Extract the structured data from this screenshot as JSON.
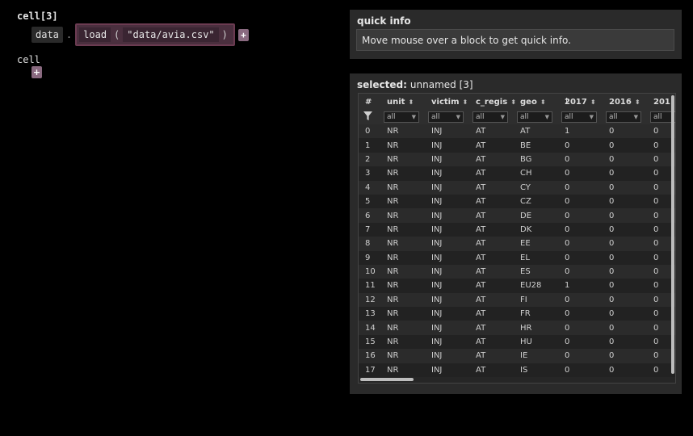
{
  "cells": {
    "cell1_title": "cell[3]",
    "obj_token": "data",
    "dot": ".",
    "fn_name": "load",
    "paren_open": "(",
    "arg": "\"data/avia.csv\"",
    "paren_close": ")",
    "plus": "+",
    "cell2_label": "cell"
  },
  "quick_info": {
    "title": "quick info",
    "text": "Move mouse over a block to get quick info."
  },
  "selected": {
    "label": "selected:",
    "name": "unnamed [3]"
  },
  "table": {
    "columns": [
      "#",
      "unit",
      "victim",
      "c_regis",
      "geo",
      "2017",
      "2016",
      "201"
    ],
    "filter_value": "all",
    "rows": [
      [
        "0",
        "NR",
        "INJ",
        "AT",
        "AT",
        "1",
        "0",
        "0"
      ],
      [
        "1",
        "NR",
        "INJ",
        "AT",
        "BE",
        "0",
        "0",
        "0"
      ],
      [
        "2",
        "NR",
        "INJ",
        "AT",
        "BG",
        "0",
        "0",
        "0"
      ],
      [
        "3",
        "NR",
        "INJ",
        "AT",
        "CH",
        "0",
        "0",
        "0"
      ],
      [
        "4",
        "NR",
        "INJ",
        "AT",
        "CY",
        "0",
        "0",
        "0"
      ],
      [
        "5",
        "NR",
        "INJ",
        "AT",
        "CZ",
        "0",
        "0",
        "0"
      ],
      [
        "6",
        "NR",
        "INJ",
        "AT",
        "DE",
        "0",
        "0",
        "0"
      ],
      [
        "7",
        "NR",
        "INJ",
        "AT",
        "DK",
        "0",
        "0",
        "0"
      ],
      [
        "8",
        "NR",
        "INJ",
        "AT",
        "EE",
        "0",
        "0",
        "0"
      ],
      [
        "9",
        "NR",
        "INJ",
        "AT",
        "EL",
        "0",
        "0",
        "0"
      ],
      [
        "10",
        "NR",
        "INJ",
        "AT",
        "ES",
        "0",
        "0",
        "0"
      ],
      [
        "11",
        "NR",
        "INJ",
        "AT",
        "EU28",
        "1",
        "0",
        "0"
      ],
      [
        "12",
        "NR",
        "INJ",
        "AT",
        "FI",
        "0",
        "0",
        "0"
      ],
      [
        "13",
        "NR",
        "INJ",
        "AT",
        "FR",
        "0",
        "0",
        "0"
      ],
      [
        "14",
        "NR",
        "INJ",
        "AT",
        "HR",
        "0",
        "0",
        "0"
      ],
      [
        "15",
        "NR",
        "INJ",
        "AT",
        "HU",
        "0",
        "0",
        "0"
      ],
      [
        "16",
        "NR",
        "INJ",
        "AT",
        "IE",
        "0",
        "0",
        "0"
      ],
      [
        "17",
        "NR",
        "INJ",
        "AT",
        "IS",
        "0",
        "0",
        "0"
      ]
    ]
  },
  "icons": {
    "filter": "filter-icon",
    "sort": "sort-arrows-icon",
    "plus": "plus-icon"
  }
}
